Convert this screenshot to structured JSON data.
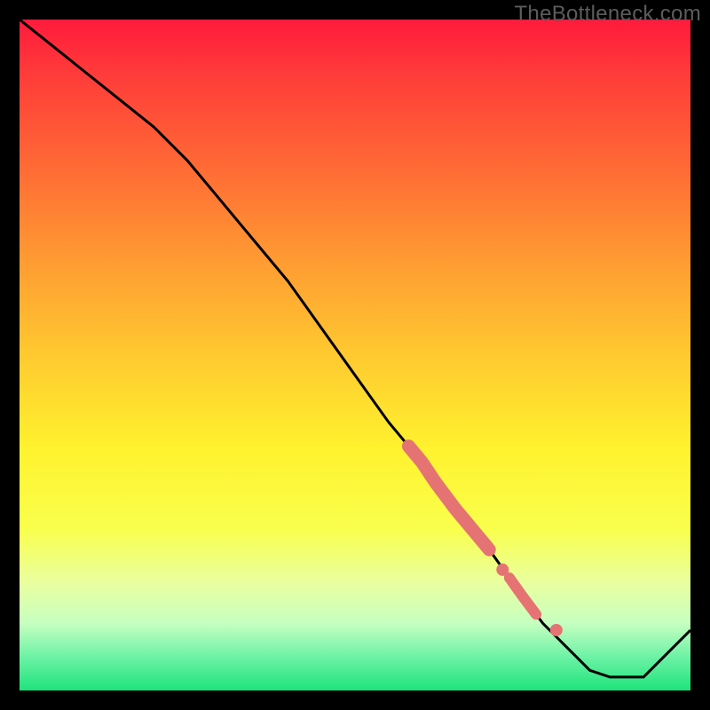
{
  "watermark": "TheBottleneck.com",
  "colors": {
    "gradient_top": "#ff1a3c",
    "gradient_mid": "#fff22e",
    "gradient_bottom": "#1fe37a",
    "line": "#000000",
    "markers": "#e57373",
    "frame": "#000000"
  },
  "chart_data": {
    "type": "line",
    "title": "",
    "xlabel": "",
    "ylabel": "",
    "xlim": [
      0,
      100
    ],
    "ylim": [
      0,
      100
    ],
    "grid": false,
    "legend": false,
    "series": [
      {
        "name": "curve",
        "x": [
          0,
          5,
          10,
          15,
          20,
          25,
          30,
          35,
          40,
          45,
          50,
          55,
          60,
          62,
          65,
          70,
          75,
          78,
          80,
          83,
          85,
          88,
          90,
          93,
          96,
          100
        ],
        "y": [
          100,
          96,
          92,
          88,
          84,
          79,
          73,
          67,
          61,
          54,
          47,
          40,
          34,
          31,
          27,
          21,
          14,
          10,
          8,
          5,
          3,
          2,
          2,
          2,
          5,
          9
        ]
      }
    ],
    "markers": [
      {
        "name": "cluster-upper",
        "kind": "segment",
        "x_range": [
          58,
          70
        ],
        "value_hint": "dense points along curve, approx y 36→21"
      },
      {
        "name": "point-a",
        "x": 72,
        "y": 18
      },
      {
        "name": "cluster-mid",
        "kind": "segment",
        "x_range": [
          73,
          77
        ],
        "value_hint": "short dense band on curve, approx y 16→12"
      },
      {
        "name": "point-b",
        "x": 80,
        "y": 9
      }
    ],
    "annotations": []
  }
}
